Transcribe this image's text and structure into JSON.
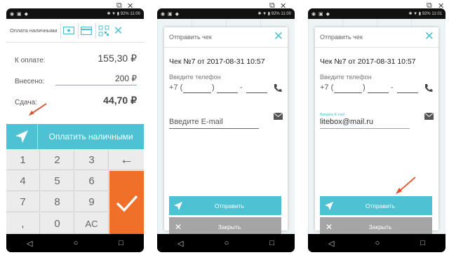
{
  "colors": {
    "accent": "#4ec1d3",
    "ok": "#f07029",
    "close_btn": "#a5a5a5",
    "arrow": "#e0502a"
  },
  "phone1": {
    "status": {
      "time": "11:00",
      "battery": "92%"
    },
    "header": {
      "title": "Оплата наличными",
      "icons": [
        "card-icon",
        "wallet-icon",
        "qr-icon",
        "close-icon"
      ]
    },
    "to_pay": {
      "label": "К оплате:",
      "value": "155,30 ₽"
    },
    "paid": {
      "label": "Внесено:",
      "value": "200 ₽"
    },
    "change": {
      "label": "Сдача:",
      "value": "44,70 ₽"
    },
    "pay_button": "Оплатить наличными",
    "keypad": [
      "1",
      "2",
      "3",
      "←",
      "4",
      "5",
      "6",
      "7",
      "8",
      "9",
      ",",
      "0",
      "AC"
    ]
  },
  "phone2": {
    "status": {
      "time": "11:00",
      "battery": "92%"
    },
    "dialog": {
      "title": "Отправить чек",
      "check": "Чек №7 от 2017-08-31 10:57",
      "phone_label": "Введите телефон",
      "phone_prefix": "+7 (",
      "phone_sep1": ")",
      "phone_sep2": "-",
      "email_placeholder": "Введите E-mail",
      "send": "Отправить",
      "close": "Закрыть"
    }
  },
  "phone3": {
    "status": {
      "time": "11:01",
      "battery": "92%"
    },
    "dialog": {
      "title": "Отправить чек",
      "check": "Чек №7 от 2017-08-31 10:57",
      "phone_label": "Введите телефон",
      "phone_prefix": "+7 (",
      "phone_sep1": ")",
      "phone_sep2": "-",
      "email_hint": "Введите E-mail",
      "email_value": "litebox@mail.ru",
      "send": "Отправить",
      "close": "Закрыть"
    }
  }
}
